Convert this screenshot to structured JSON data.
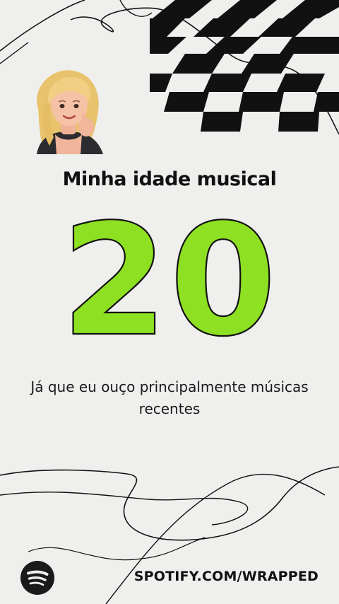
{
  "story": {
    "heading": "Minha idade musical",
    "age_value": "20",
    "description": "Já que eu ouço principalmente músicas recentes",
    "footer_url": "SPOTIFY.COM/WRAPPED"
  },
  "colors": {
    "background": "#efefed",
    "age_fill": "#8ee022",
    "ink": "#111111"
  },
  "icons": {
    "brand": "spotify-logo-icon",
    "avatar": "avatar-illustration"
  }
}
